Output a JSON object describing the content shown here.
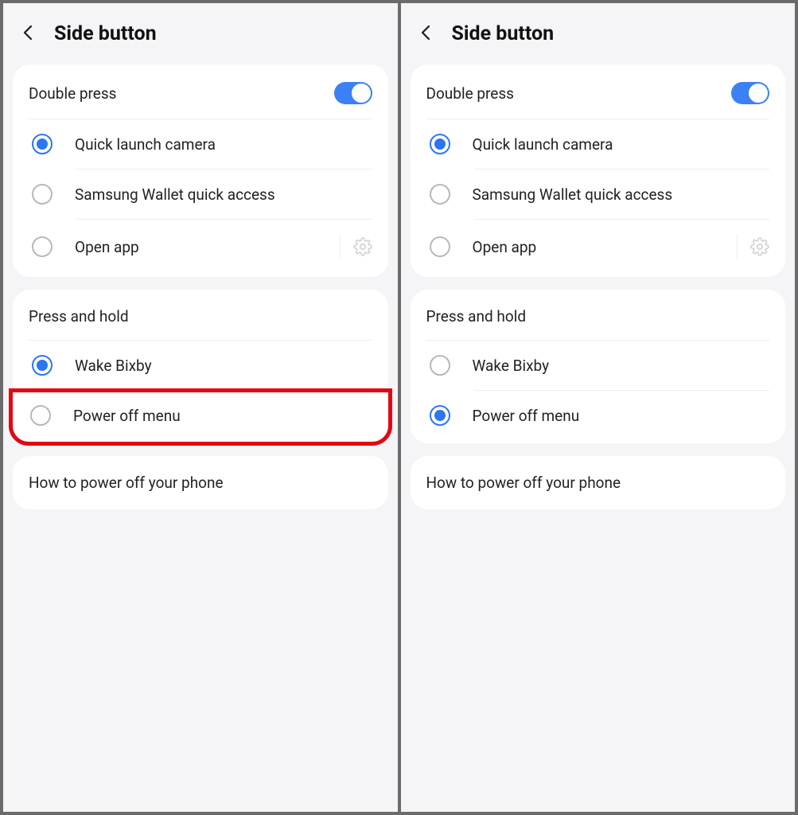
{
  "left": {
    "title": "Side button",
    "double_press": {
      "label": "Double press",
      "toggle_on": true,
      "options": [
        {
          "label": "Quick launch camera",
          "selected": true
        },
        {
          "label": "Samsung Wallet quick access",
          "selected": false
        },
        {
          "label": "Open app",
          "selected": false,
          "has_gear": true
        }
      ]
    },
    "press_hold": {
      "label": "Press and hold",
      "options": [
        {
          "label": "Wake Bixby",
          "selected": true
        },
        {
          "label": "Power off menu",
          "selected": false,
          "highlighted": true
        }
      ]
    },
    "footer": {
      "label": "How to power off your phone"
    }
  },
  "right": {
    "title": "Side button",
    "double_press": {
      "label": "Double press",
      "toggle_on": true,
      "options": [
        {
          "label": "Quick launch camera",
          "selected": true
        },
        {
          "label": "Samsung Wallet quick access",
          "selected": false
        },
        {
          "label": "Open app",
          "selected": false,
          "has_gear": true
        }
      ]
    },
    "press_hold": {
      "label": "Press and hold",
      "options": [
        {
          "label": "Wake Bixby",
          "selected": false
        },
        {
          "label": "Power off menu",
          "selected": true
        }
      ]
    },
    "footer": {
      "label": "How to power off your phone"
    }
  }
}
